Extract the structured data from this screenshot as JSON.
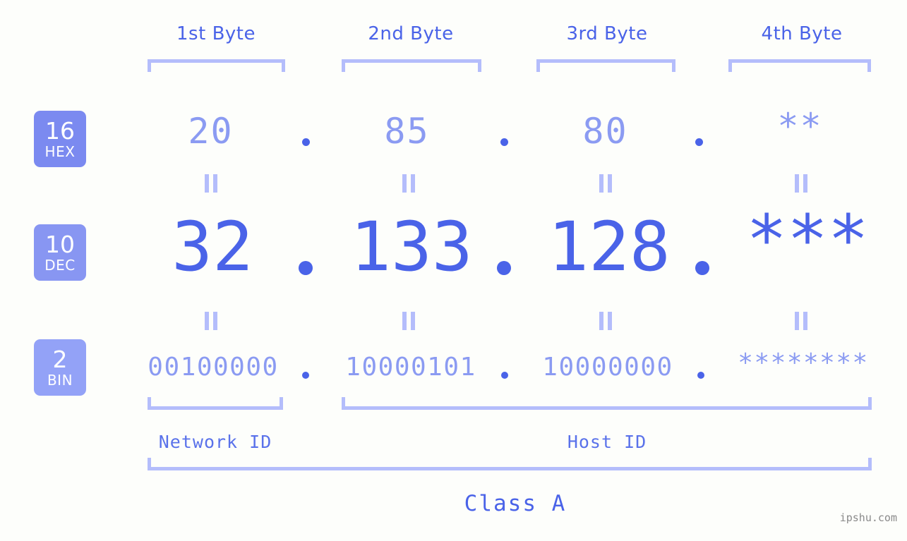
{
  "watermark": "ipshu.com",
  "colors": {
    "background": "#fdfefb",
    "accent_strong": "#4a63e8",
    "accent_mid": "#8b9bf2",
    "accent_light": "#b4bdfb",
    "badge_hex": "#7b8af0",
    "badge_dec": "#8896f2",
    "badge_bin": "#93a2f7",
    "badge_text": "#ffffff"
  },
  "byte_headers": [
    {
      "label": "1st Byte"
    },
    {
      "label": "2nd Byte"
    },
    {
      "label": "3rd Byte"
    },
    {
      "label": "4th Byte"
    }
  ],
  "rows": {
    "hex": {
      "badge_number": "16",
      "badge_radix": "HEX",
      "values": [
        "20",
        "85",
        "80",
        "**"
      ],
      "separator": "."
    },
    "dec": {
      "badge_number": "10",
      "badge_radix": "DEC",
      "values": [
        "32",
        "133",
        "128",
        "***"
      ],
      "separator": "."
    },
    "bin": {
      "badge_number": "2",
      "badge_radix": "BIN",
      "values": [
        "00100000",
        "10000101",
        "10000000",
        "********"
      ],
      "separator": "."
    }
  },
  "equals_marker": "=",
  "segments": {
    "network_id": "Network ID",
    "host_id": "Host ID"
  },
  "class_label": "Class A"
}
